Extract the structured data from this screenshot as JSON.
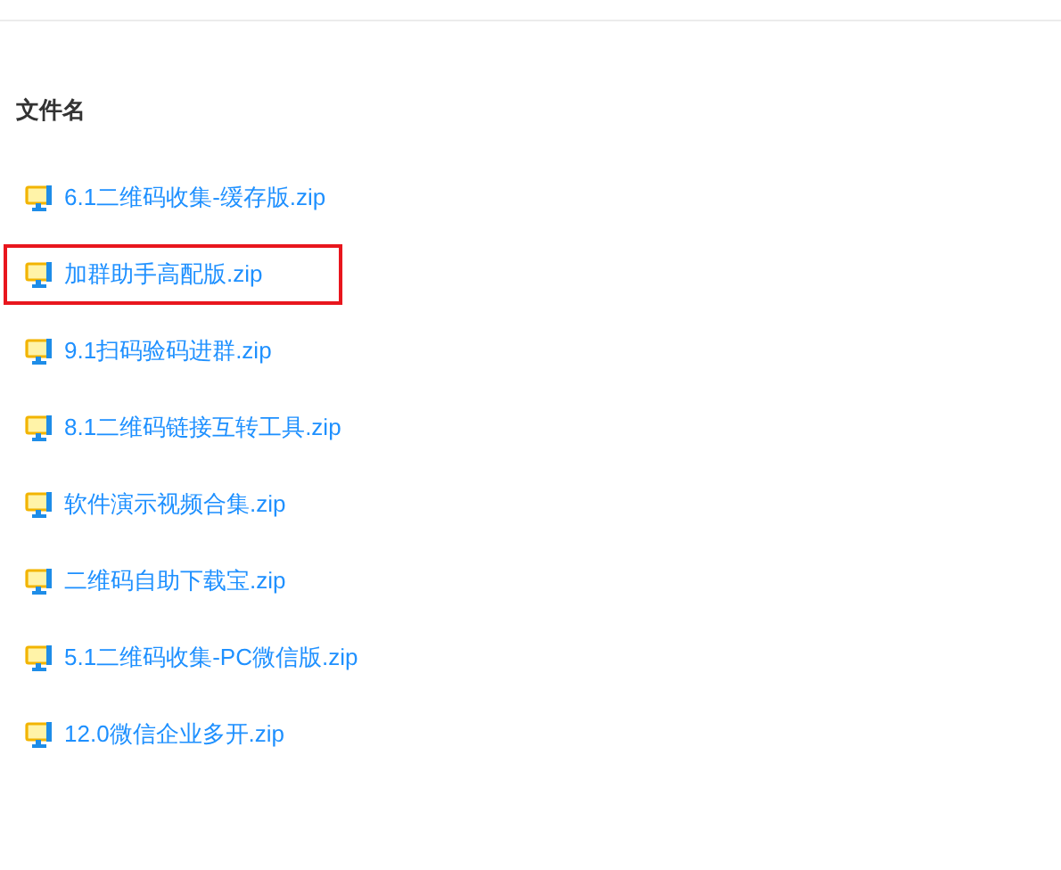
{
  "header": "文件名",
  "files": [
    {
      "name": "6.1二维码收集-缓存版.zip",
      "highlighted": false
    },
    {
      "name": "加群助手高配版.zip",
      "highlighted": true
    },
    {
      "name": "9.1扫码验码进群.zip",
      "highlighted": false
    },
    {
      "name": "8.1二维码链接互转工具.zip",
      "highlighted": false
    },
    {
      "name": "软件演示视频合集.zip",
      "highlighted": false
    },
    {
      "name": "二维码自助下载宝.zip",
      "highlighted": false
    },
    {
      "name": "5.1二维码收集-PC微信版.zip",
      "highlighted": false
    },
    {
      "name": "12.0微信企业多开.zip",
      "highlighted": false
    }
  ]
}
